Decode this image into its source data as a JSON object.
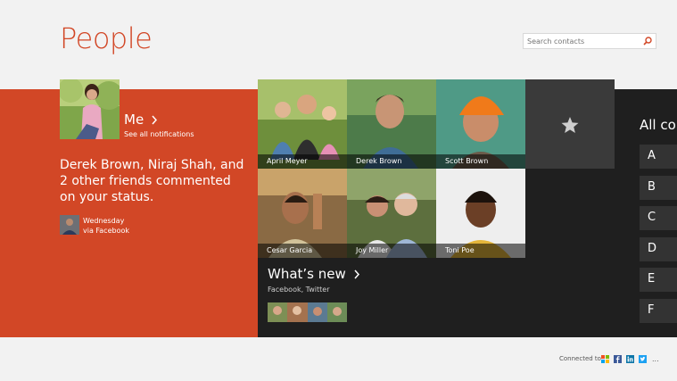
{
  "app": {
    "title": "People"
  },
  "search": {
    "placeholder": "Search contacts",
    "value": ""
  },
  "me": {
    "label": "Me",
    "notifications_link": "See all notifications",
    "status_text": "Derek Brown, Niraj Shah, and 2 other friends commented on your status.",
    "day": "Wednesday",
    "source": "via Facebook"
  },
  "contacts": [
    {
      "name": "April Meyer"
    },
    {
      "name": "Derek Brown"
    },
    {
      "name": "Scott Brown"
    },
    {
      "name": "Cesar Garcia"
    },
    {
      "name": "Joy Miller"
    },
    {
      "name": "Toni Poe"
    }
  ],
  "favorites": {
    "icon": "star-icon"
  },
  "whats_new": {
    "title": "What’s new",
    "subtitle": "Facebook, Twitter"
  },
  "all_contacts": {
    "title": "All co",
    "letters": [
      "A",
      "B",
      "C",
      "D",
      "E",
      "F"
    ]
  },
  "footer": {
    "connected_label": "Connected to",
    "more": "..."
  },
  "colors": {
    "accent": "#d24726",
    "dark_band": "#1f1f1f",
    "tile_gray": "#3a3a3a",
    "background": "#f2f2f2"
  }
}
